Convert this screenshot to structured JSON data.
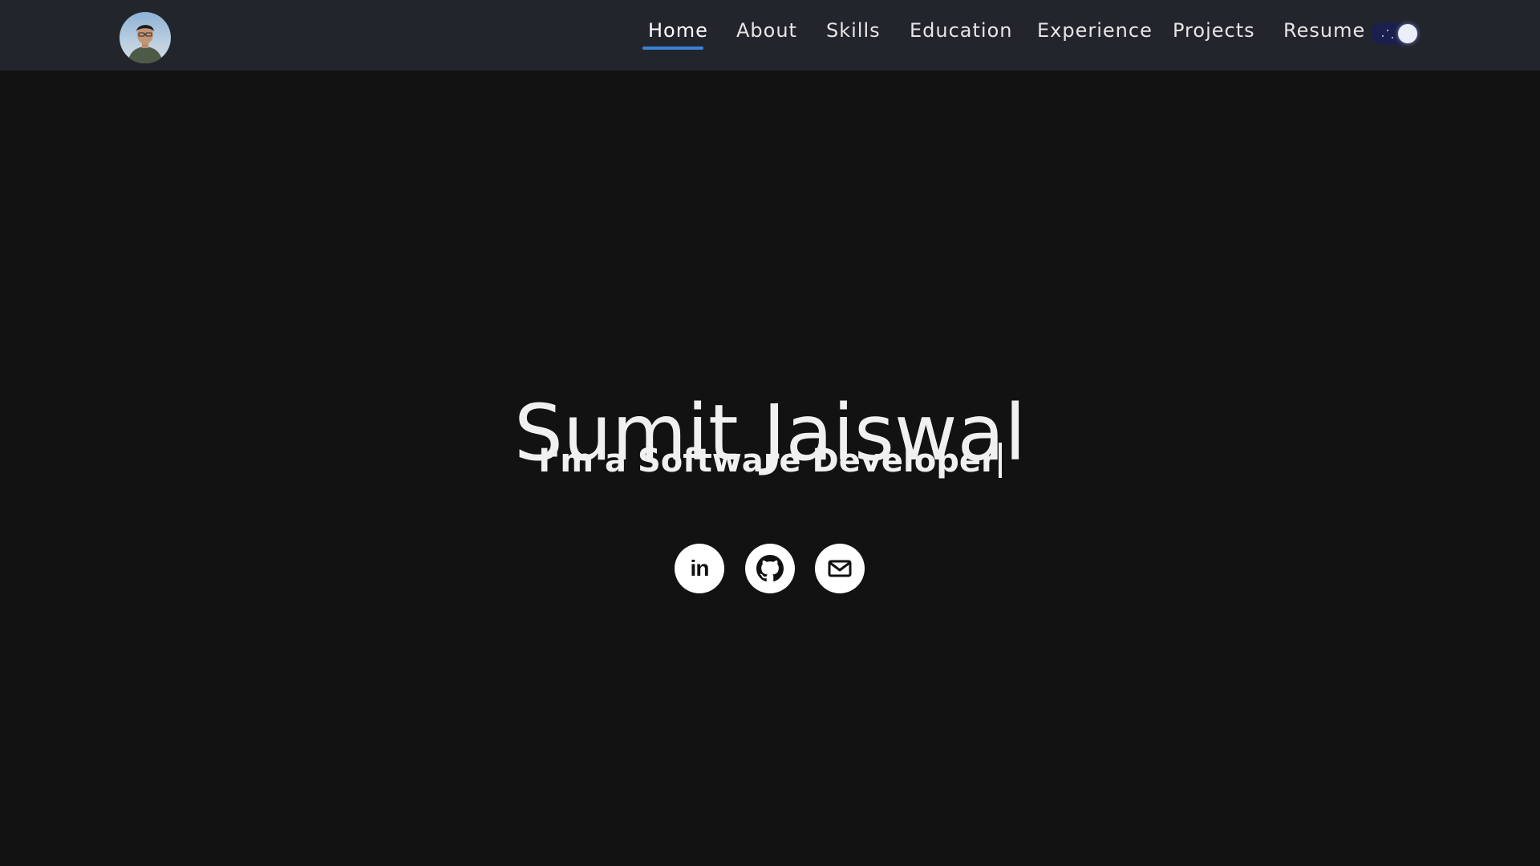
{
  "nav": {
    "items": [
      {
        "label": "Home",
        "active": true
      },
      {
        "label": "About",
        "active": false
      },
      {
        "label": "Skills",
        "active": false
      },
      {
        "label": "Education",
        "active": false
      },
      {
        "label": "Experience",
        "active": false
      },
      {
        "label": "Projects",
        "active": false
      },
      {
        "label": "Resume",
        "active": false
      }
    ],
    "theme_toggle": {
      "state": "dark"
    }
  },
  "hero": {
    "name": "Sumit Jaiswal",
    "tagline": "I'm a Software Developer"
  },
  "social": [
    {
      "icon": "linkedin-icon",
      "text": "in"
    },
    {
      "icon": "github-icon"
    },
    {
      "icon": "mail-icon"
    }
  ],
  "colors": {
    "background": "#121212",
    "navbar": "#22262c",
    "accent": "#3b82d6",
    "toggle": "#1a1f4d"
  }
}
